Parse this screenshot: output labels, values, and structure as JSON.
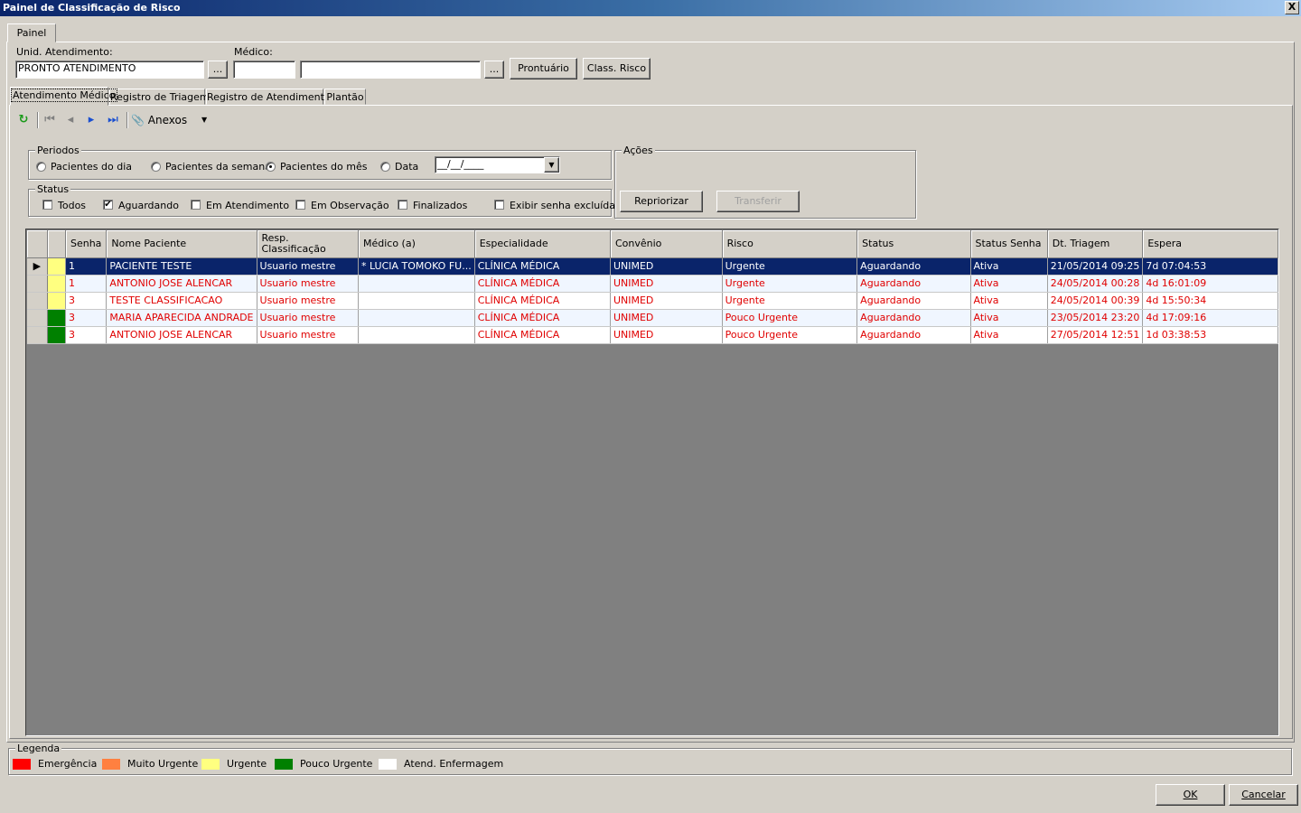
{
  "window": {
    "title": "Painel de Classificação de Risco",
    "close_label": "X"
  },
  "outer_tab": {
    "label": "Painel"
  },
  "unid": {
    "label": "Unid. Atendimento:",
    "value": "PRONTO ATENDIMENTO",
    "browse": "..."
  },
  "medico": {
    "label": "Médico:",
    "code_value": "",
    "name_value": "",
    "browse": "..."
  },
  "buttons": {
    "prontuario": "Prontuário",
    "class_risco": "Class. Risco",
    "repriorizar": "Repriorizar",
    "transferir": "Transferir",
    "ok": "OK",
    "cancelar": "Cancelar"
  },
  "inner_tabs": [
    {
      "label": "Atendimento Médico"
    },
    {
      "label": "Registro de Triagem"
    },
    {
      "label": "Registro de Atendimento"
    },
    {
      "label": "Plantão"
    }
  ],
  "toolbar": {
    "anexos": "Anexos"
  },
  "periodos": {
    "title": "Periodos",
    "options": [
      "Pacientes do dia",
      "Pacientes da semana",
      "Pacientes do mês",
      "Data"
    ],
    "selected": "Pacientes do mês",
    "date_value": "__/__/____"
  },
  "acoes": {
    "title": "Ações"
  },
  "status": {
    "title": "Status",
    "options": [
      {
        "label": "Todos",
        "checked": false
      },
      {
        "label": "Aguardando",
        "checked": true
      },
      {
        "label": "Em Atendimento",
        "checked": false
      },
      {
        "label": "Em Observação",
        "checked": false
      },
      {
        "label": "Finalizados",
        "checked": false
      },
      {
        "label": "Exibir senha excluída",
        "checked": false
      }
    ]
  },
  "grid": {
    "columns": [
      "",
      "",
      "Senha",
      "Nome Paciente",
      "Resp. Classificação",
      "Médico (a)",
      "Especialidade",
      "Convênio",
      "Risco",
      "Status",
      "Status Senha",
      "Dt. Triagem",
      "Espera"
    ],
    "rows": [
      {
        "color": "#ffff80",
        "senha": "1",
        "nome": "PACIENTE TESTE",
        "resp": "Usuario mestre",
        "medico": "* LUCIA TOMOKO FU...",
        "especialidade": "CLÍNICA MÉDICA",
        "convenio": "UNIMED",
        "risco": "Urgente",
        "status": "Aguardando",
        "status_senha": "Ativa",
        "dt_triagem": "21/05/2014 09:25",
        "espera": "7d 07:04:53",
        "selected": true
      },
      {
        "color": "#ffff80",
        "senha": "1",
        "nome": "ANTONIO JOSE ALENCAR",
        "resp": "Usuario mestre",
        "medico": "",
        "especialidade": "CLÍNICA MÉDICA",
        "convenio": "UNIMED",
        "risco": "Urgente",
        "status": "Aguardando",
        "status_senha": "Ativa",
        "dt_triagem": "24/05/2014 00:28",
        "espera": "4d 16:01:09",
        "selected": false
      },
      {
        "color": "#ffff80",
        "senha": "3",
        "nome": "TESTE CLASSIFICACAO",
        "resp": "Usuario mestre",
        "medico": "",
        "especialidade": "CLÍNICA MÉDICA",
        "convenio": "UNIMED",
        "risco": "Urgente",
        "status": "Aguardando",
        "status_senha": "Ativa",
        "dt_triagem": "24/05/2014 00:39",
        "espera": "4d 15:50:34",
        "selected": false
      },
      {
        "color": "#008000",
        "senha": "3",
        "nome": "MARIA APARECIDA ANDRADE",
        "resp": "Usuario mestre",
        "medico": "",
        "especialidade": "CLÍNICA MÉDICA",
        "convenio": "UNIMED",
        "risco": "Pouco Urgente",
        "status": "Aguardando",
        "status_senha": "Ativa",
        "dt_triagem": "23/05/2014 23:20",
        "espera": "4d 17:09:16",
        "selected": false
      },
      {
        "color": "#008000",
        "senha": "3",
        "nome": "ANTONIO JOSE ALENCAR",
        "resp": "Usuario mestre",
        "medico": "",
        "especialidade": "CLÍNICA MÉDICA",
        "convenio": "UNIMED",
        "risco": "Pouco Urgente",
        "status": "Aguardando",
        "status_senha": "Ativa",
        "dt_triagem": "27/05/2014 12:51",
        "espera": "1d 03:38:53",
        "selected": false
      }
    ]
  },
  "legenda": {
    "title": "Legenda",
    "items": [
      {
        "label": "Emergência",
        "color": "#ff0000"
      },
      {
        "label": "Muito Urgente",
        "color": "#ff8040"
      },
      {
        "label": "Urgente",
        "color": "#ffff80"
      },
      {
        "label": "Pouco Urgente",
        "color": "#008000"
      },
      {
        "label": "Atend. Enfermagem",
        "color": "#ffffff"
      }
    ]
  }
}
